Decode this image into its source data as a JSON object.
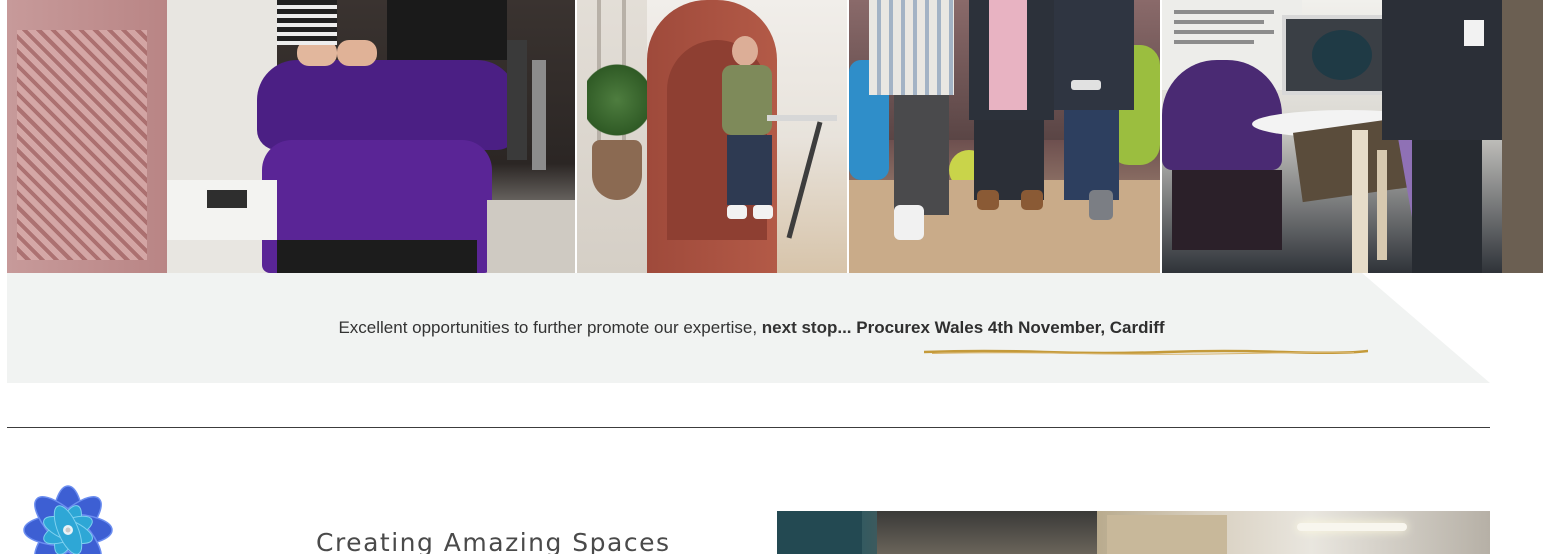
{
  "promo": {
    "intro": "Excellent opportunities to further promote our expertise, ",
    "highlight": "next stop... ",
    "event": "Procurex Wales 4th November, Cardiff"
  },
  "tagline": "Creating Amazing Spaces",
  "icons": {
    "logo": "blue-flower-logo-icon"
  },
  "colors": {
    "banner_bg": "#f1f3f2",
    "underline": "#c49a3a",
    "divider": "#3c3c3c",
    "text": "#333333",
    "logo_blue": "#3d5fd3"
  }
}
